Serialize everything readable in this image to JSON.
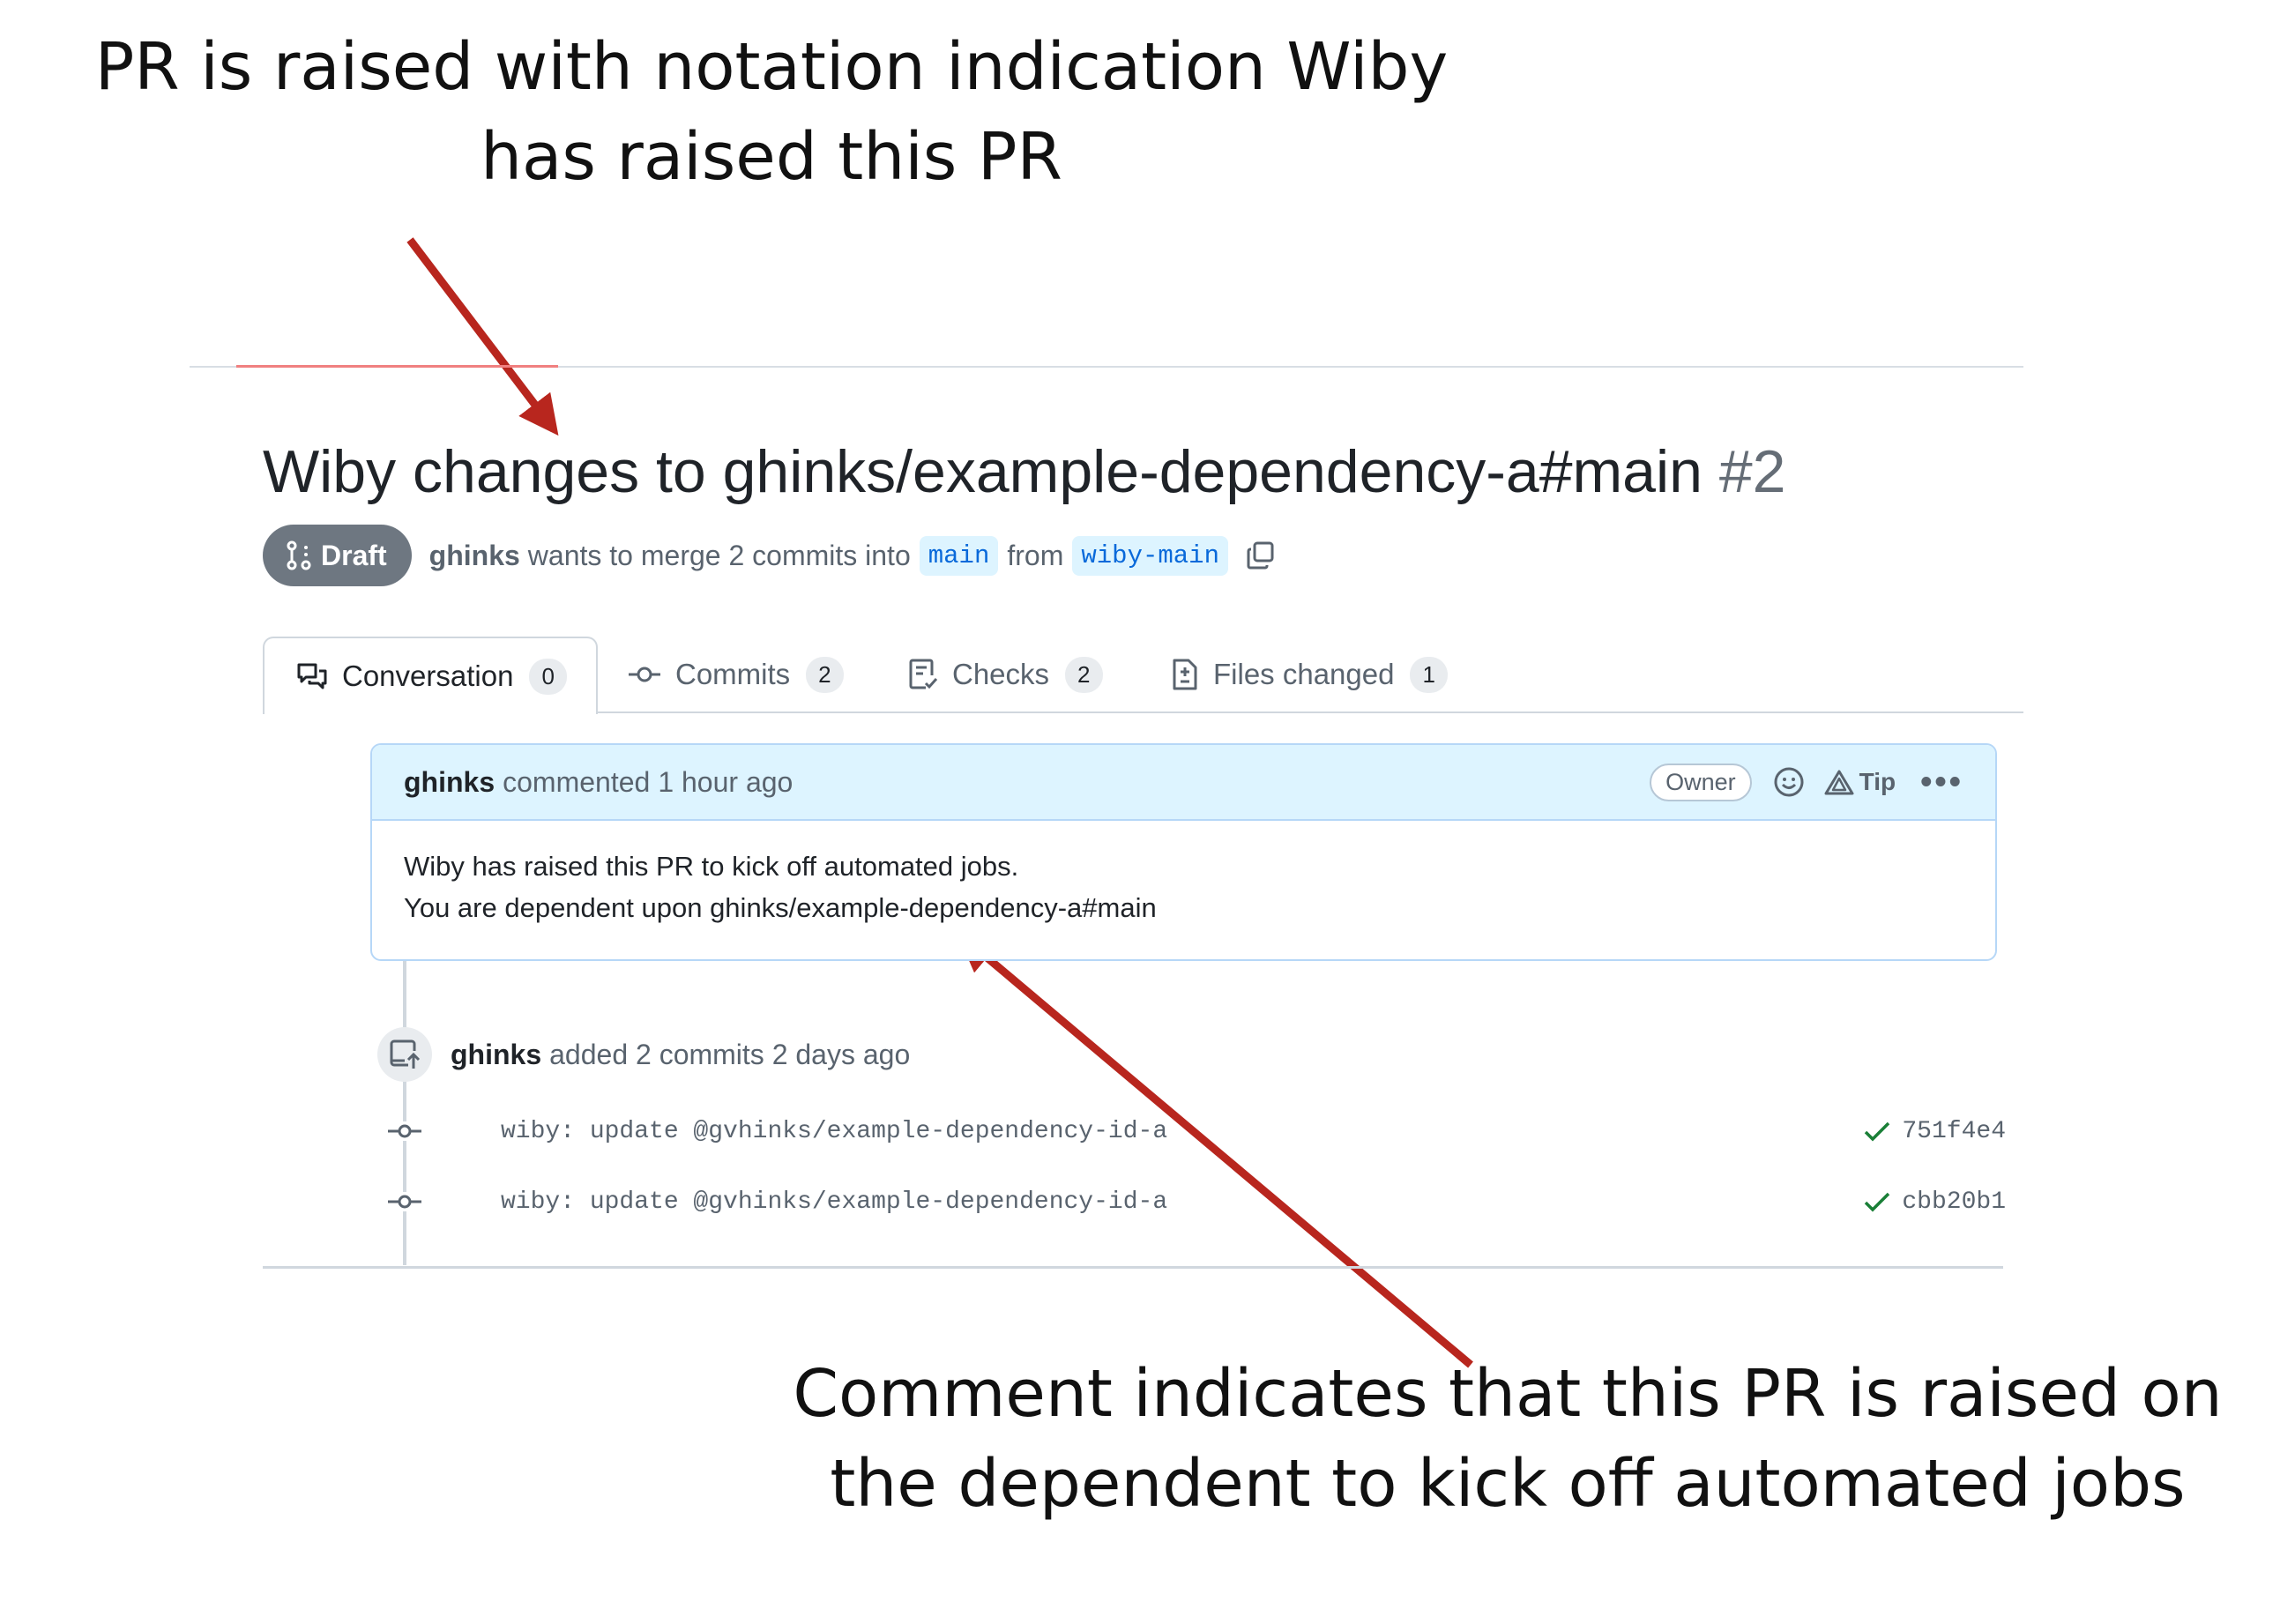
{
  "annotations": {
    "top": "PR is raised with notation indication Wiby has raised this PR",
    "bottom": "Comment indicates that this PR is raised on the dependent to kick off automated jobs",
    "arrow_color": "#b8261e"
  },
  "pr": {
    "title": "Wiby changes to ghinks/example-dependency-a#main",
    "number": "#2",
    "state": "Draft",
    "author": "ghinks",
    "merge_text_1": "wants to merge 2 commits into",
    "base_branch": "main",
    "from_text": "from",
    "head_branch": "wiby-main"
  },
  "tabs": [
    {
      "label": "Conversation",
      "count": "0",
      "icon": "comment-discussion-icon",
      "active": true
    },
    {
      "label": "Commits",
      "count": "2",
      "icon": "git-commit-icon",
      "active": false
    },
    {
      "label": "Checks",
      "count": "2",
      "icon": "checklist-icon",
      "active": false
    },
    {
      "label": "Files changed",
      "count": "1",
      "icon": "file-diff-icon",
      "active": false
    }
  ],
  "comment": {
    "author": "ghinks",
    "action": "commented",
    "time": "1 hour ago",
    "role_badge": "Owner",
    "tip_label": "Tip",
    "body_line_1": "Wiby has raised this PR to kick off automated jobs.",
    "body_line_2": "You are dependent upon ghinks/example-dependency-a#main"
  },
  "commit_event": {
    "author": "ghinks",
    "text": "added 2 commits 2 days ago"
  },
  "commits": [
    {
      "message": "wiby: update @gvhinks/example-dependency-id-a",
      "sha": "751f4e4",
      "status": "success"
    },
    {
      "message": "wiby: update @gvhinks/example-dependency-id-a",
      "sha": "cbb20b1",
      "status": "success"
    }
  ],
  "colors": {
    "draft_badge": "#6e7781",
    "branch_bg": "#ddf4ff",
    "branch_text": "#0969da",
    "comment_header_bg": "#ddf4ff",
    "success_check": "#1a7f37"
  }
}
